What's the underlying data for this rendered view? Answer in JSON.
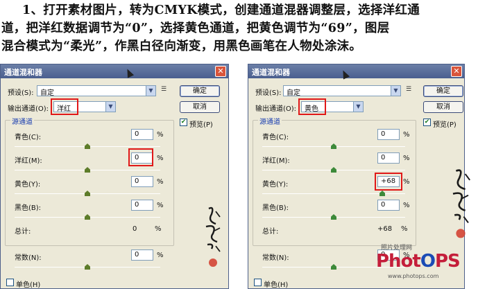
{
  "instructions": {
    "line1": "1、打开素材图片，转为CMYK模式，创建通道混器调整层，选择洋红通",
    "line2": "道，把洋红数据调节为“0”，选择黄色通道，把黄色调节为“69”，图层",
    "line3": "混合模式为“柔光”，作黑白径向渐变，用黑色画笔在人物处涂沫。"
  },
  "dialog_left": {
    "title": "通道混和器",
    "preset_label": "预设(S):",
    "preset_value": "自定",
    "ok": "确定",
    "cancel": "取消",
    "preview": "预览(P)",
    "output_label": "输出通道(O):",
    "output_value": "洋红",
    "source_group": "源通道",
    "cyan_label": "青色(C):",
    "cyan_value": "0",
    "magenta_label": "洋红(M):",
    "magenta_value": "0",
    "yellow_label": "黄色(Y):",
    "yellow_value": "0",
    "black_label": "黑色(B):",
    "black_value": "0",
    "total_label": "总计:",
    "total_value": "0",
    "constant_label": "常数(N):",
    "constant_value": "0",
    "mono_label": "单色(H)",
    "percent": "%",
    "cyan_slider": 0.5,
    "magenta_slider": 0.5,
    "yellow_slider": 0.5,
    "black_slider": 0.5,
    "constant_slider": 0.5
  },
  "dialog_right": {
    "title": "通道混和器",
    "preset_label": "预设(S):",
    "preset_value": "自定",
    "ok": "确定",
    "cancel": "取消",
    "preview": "预览(P)",
    "output_label": "输出通道(O):",
    "output_value": "黄色",
    "source_group": "源通道",
    "cyan_label": "青色(C):",
    "cyan_value": "0",
    "magenta_label": "洋红(M):",
    "magenta_value": "0",
    "yellow_label": "黄色(Y):",
    "yellow_value": "+68",
    "black_label": "黑色(B):",
    "black_value": "0",
    "total_label": "总计:",
    "total_value": "+68",
    "constant_label": "常数(N):",
    "constant_value": "0",
    "mono_label": "单色(H)",
    "percent": "%",
    "cyan_slider": 0.5,
    "magenta_slider": 0.5,
    "yellow_slider": 0.84,
    "black_slider": 0.5,
    "constant_slider": 0.5
  },
  "watermark": {
    "top": "照片处理网",
    "brand_a": "Phot",
    "brand_b": "O",
    "brand_c": "PS",
    "bottom": "www.photops.com"
  },
  "colors": {
    "highlight": "#e01818",
    "title_bar": "#4a5f8f",
    "dialog_bg": "#ece9d8"
  }
}
